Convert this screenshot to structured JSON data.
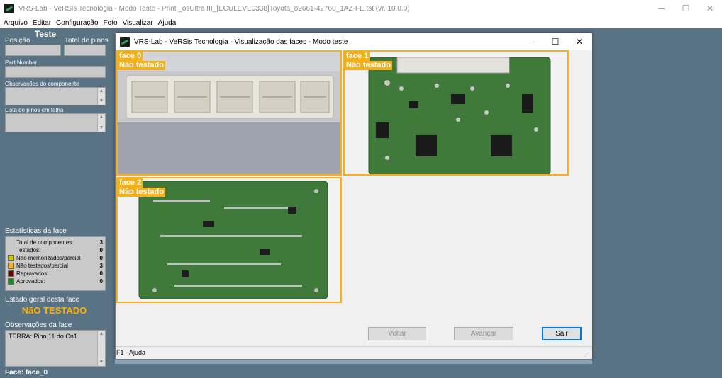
{
  "window": {
    "title": "VRS-Lab - VeRSis Tecnologia - Modo Teste - Print _osUltra III_[ECULEVE0338]Toyota_89661-42760_1AZ-FE.tst (vr. 10.0.0)",
    "minimize": "─",
    "maximize": "☐",
    "close": "✕"
  },
  "menu": [
    "Arquivo",
    "Editar",
    "Configuração",
    "Foto",
    "Visualizar",
    "Ajuda"
  ],
  "left": {
    "section_title": "Teste",
    "posicao_label": "Posição",
    "total_pinos_label": "Total de pinos",
    "part_number_label": "Part Number",
    "obs_componente_label": "Observações do componente",
    "pinos_falha_label": "Lista de pinos em falha",
    "stats_title": "Estatísticas da face",
    "stats": [
      {
        "label": "Total de componentes:",
        "value": "3",
        "color": ""
      },
      {
        "label": "Testados:",
        "value": "0",
        "color": ""
      },
      {
        "label": "Não memorizados/parcial",
        "value": "0",
        "color": "#c8c800"
      },
      {
        "label": "Não testados/parcial",
        "value": "3",
        "color": "#f5b01a"
      },
      {
        "label": "Reprovados:",
        "value": "0",
        "color": "#7a0000"
      },
      {
        "label": "Aprovados:",
        "value": "0",
        "color": "#1a8a1a"
      }
    ],
    "estado_label": "Estado geral desta face",
    "estado_value": "NãO TESTADO",
    "obs_face_label": "Observações da face",
    "obs_face_text": "TERRA: Pino 11 do Cn1",
    "face_footer": "Face: face_0"
  },
  "dialog": {
    "title": "VRS-Lab - VeRSis Tecnologia - Visualização das faces - Modo teste",
    "minimize": "─",
    "maximize": "☐",
    "close": "✕",
    "faces": [
      {
        "name": "face  0",
        "status": "Não testado"
      },
      {
        "name": "face  1",
        "status": "Não testado"
      },
      {
        "name": "face  2",
        "status": "Não testado"
      }
    ],
    "btn_voltar": "Voltar",
    "btn_avancar": "Avançar",
    "btn_sair": "Sair",
    "status_text": "F1 - Ajuda"
  },
  "colors": {
    "background": "#5a7384",
    "accent": "#f5b01a",
    "pcb_green": "#3f7a3a"
  }
}
